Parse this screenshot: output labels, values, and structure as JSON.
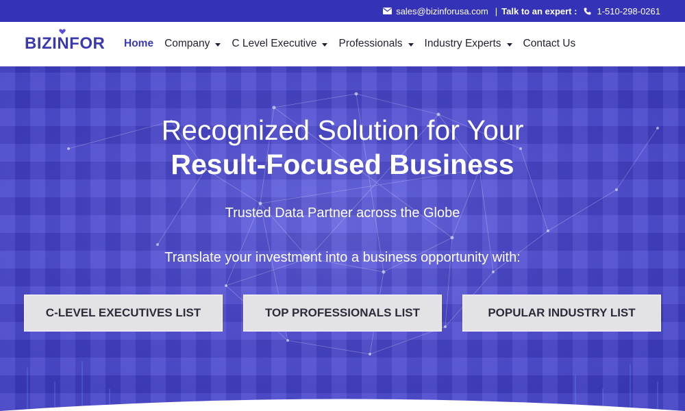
{
  "topbar": {
    "email": "sales@bizinforusa.com",
    "separator": "|",
    "expert_label": "Talk to an expert :",
    "phone": "1-510-298-0261",
    "icons": {
      "email": "envelope-icon",
      "phone": "phone-icon"
    }
  },
  "brand": {
    "logo_text": "BIZINFOR",
    "color": "#3a3ab0"
  },
  "nav": {
    "items": [
      {
        "label": "Home",
        "active": true,
        "dropdown": false
      },
      {
        "label": "Company",
        "active": false,
        "dropdown": true
      },
      {
        "label": "C Level Executive",
        "active": false,
        "dropdown": true
      },
      {
        "label": "Professionals",
        "active": false,
        "dropdown": true
      },
      {
        "label": "Industry Experts",
        "active": false,
        "dropdown": true
      },
      {
        "label": "Contact Us",
        "active": false,
        "dropdown": false
      }
    ]
  },
  "hero": {
    "title_line1": "Recognized Solution for Your",
    "title_line2": "Result-Focused Business",
    "subtitle": "Trusted Data Partner across the Globe",
    "tagline": "Translate your investment into a business opportunity with:",
    "buttons": [
      {
        "label": "C-LEVEL EXECUTIVES LIST"
      },
      {
        "label": "TOP PROFESSIONALS LIST"
      },
      {
        "label": "POPULAR INDUSTRY LIST"
      }
    ]
  },
  "colors": {
    "topbar_bg": "#3433b8",
    "hero_bg": "#4b48d0",
    "button_bg": "#e3e3e6",
    "accent": "#3a3ab0"
  }
}
